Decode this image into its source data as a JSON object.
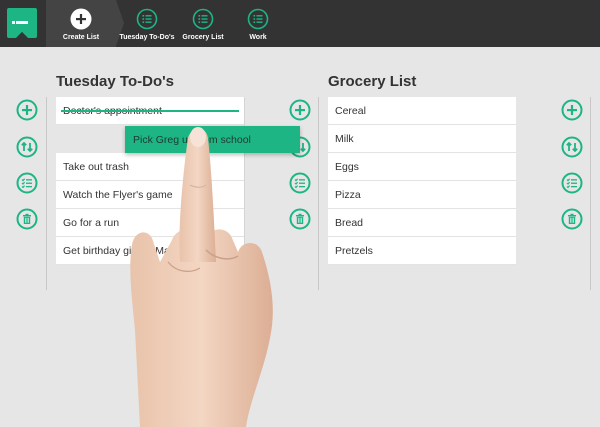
{
  "colors": {
    "accent": "#1db584",
    "topbar": "#333333",
    "background": "#e6e6e6"
  },
  "toolbar": {
    "logo_icon": "app-logo-icon",
    "create": {
      "label": "Create List",
      "icon": "plus-circle-icon"
    },
    "tabs": [
      {
        "label": "Tuesday To-Do's",
        "icon": "list-icon"
      },
      {
        "label": "Grocery List",
        "icon": "list-icon"
      },
      {
        "label": "Work",
        "icon": "list-icon"
      }
    ]
  },
  "lists": [
    {
      "title": "Tuesday To-Do's",
      "items": [
        {
          "text": "Doctor's appointment",
          "done": true
        },
        {
          "text": "Take out trash"
        },
        {
          "text": "Watch the Flyer's game"
        },
        {
          "text": "Go for a run"
        },
        {
          "text": "Get birthday gift for Ma"
        }
      ],
      "dragging_item": "Pick Greg up from school"
    },
    {
      "title": "Grocery List",
      "items": [
        {
          "text": "Cereal"
        },
        {
          "text": "Milk"
        },
        {
          "text": "Eggs"
        },
        {
          "text": "Pizza"
        },
        {
          "text": "Bread"
        },
        {
          "text": "Pretzels"
        }
      ]
    }
  ],
  "actions": [
    "add-icon",
    "sort-icon",
    "checklist-icon",
    "trash-icon"
  ]
}
